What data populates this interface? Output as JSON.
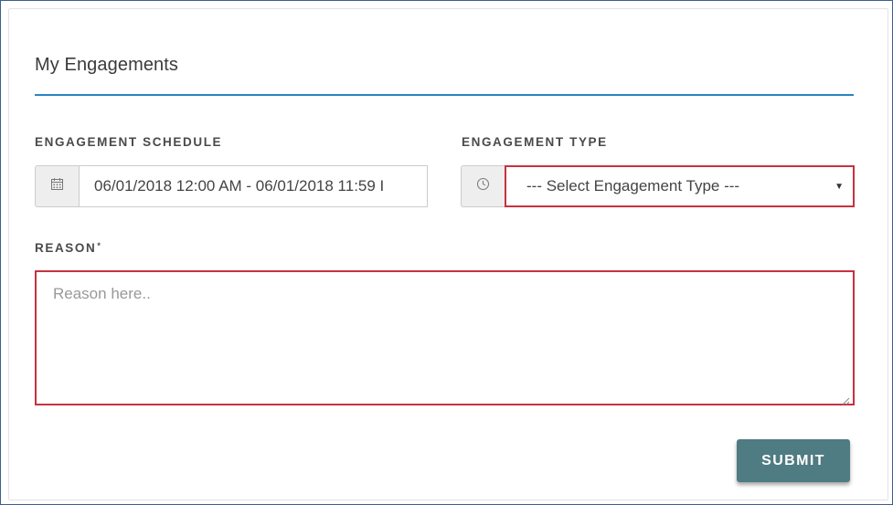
{
  "section": {
    "title": "My Engagements"
  },
  "schedule": {
    "label": "ENGAGEMENT SCHEDULE",
    "icon": "calendar-icon",
    "value": "06/01/2018 12:00 AM - 06/01/2018 11:59 I"
  },
  "engagement_type": {
    "label": "ENGAGEMENT TYPE",
    "icon": "clock-icon",
    "selected": "--- Select Engagement Type ---"
  },
  "reason": {
    "label": "REASON",
    "required_mark": "*",
    "placeholder": "Reason here.."
  },
  "actions": {
    "submit_label": "SUBMIT"
  },
  "colors": {
    "accent_rule": "#2b84c2",
    "error_border": "#c8313e",
    "button_bg": "#4f7b82"
  }
}
